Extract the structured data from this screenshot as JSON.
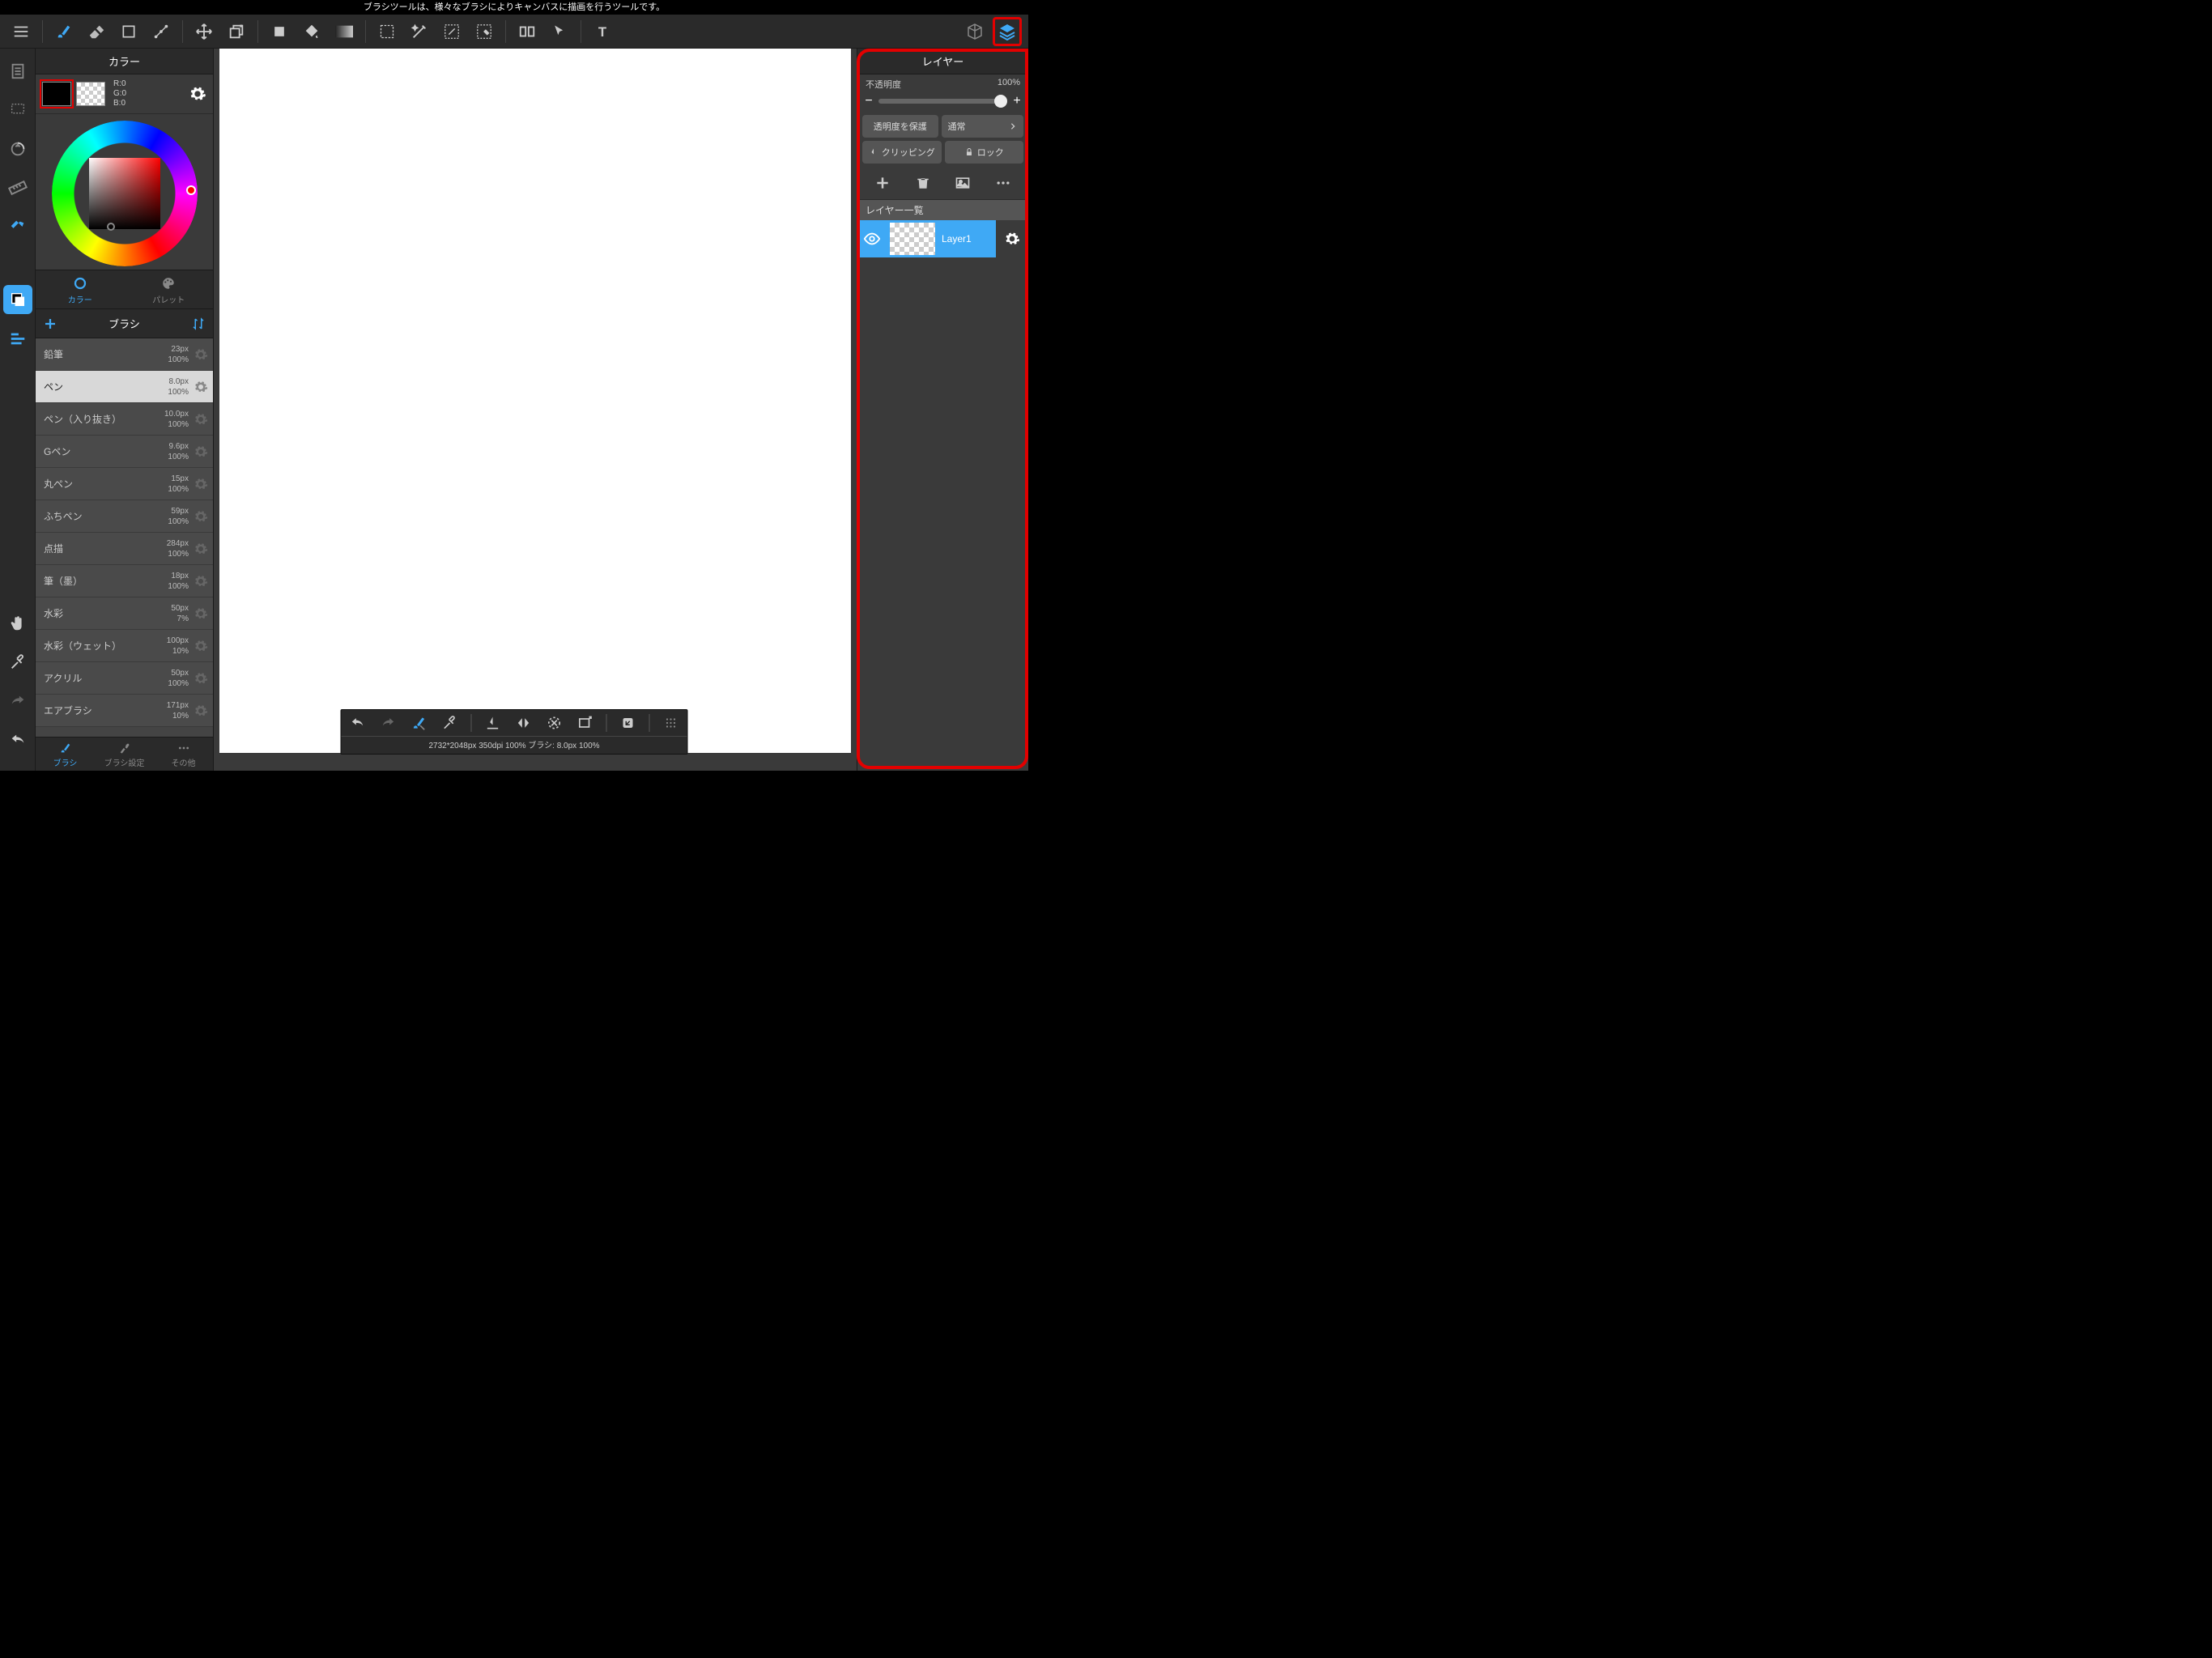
{
  "tooltip": "ブラシツールは、様々なブラシによりキャンバスに描画を行うツールです。",
  "color_panel": {
    "title": "カラー",
    "rgb": {
      "r": "R:0",
      "g": "G:0",
      "b": "B:0"
    },
    "tabs": {
      "color": "カラー",
      "palette": "パレット"
    }
  },
  "brush_panel": {
    "title": "ブラシ",
    "items": [
      {
        "name": "鉛筆",
        "size": "23px",
        "opacity": "100%"
      },
      {
        "name": "ペン",
        "size": "8.0px",
        "opacity": "100%",
        "selected": true
      },
      {
        "name": "ペン（入り抜き）",
        "size": "10.0px",
        "opacity": "100%"
      },
      {
        "name": "Gペン",
        "size": "9.6px",
        "opacity": "100%"
      },
      {
        "name": "丸ペン",
        "size": "15px",
        "opacity": "100%"
      },
      {
        "name": "ふちペン",
        "size": "59px",
        "opacity": "100%"
      },
      {
        "name": "点描",
        "size": "284px",
        "opacity": "100%"
      },
      {
        "name": "筆（墨）",
        "size": "18px",
        "opacity": "100%"
      },
      {
        "name": "水彩",
        "size": "50px",
        "opacity": "7%"
      },
      {
        "name": "水彩（ウェット）",
        "size": "100px",
        "opacity": "10%"
      },
      {
        "name": "アクリル",
        "size": "50px",
        "opacity": "100%"
      },
      {
        "name": "エアブラシ",
        "size": "171px",
        "opacity": "10%"
      }
    ],
    "footer": {
      "brush": "ブラシ",
      "settings": "ブラシ設定",
      "other": "その他"
    }
  },
  "status_bar": "2732*2048px 350dpi 100% ブラシ: 8.0px 100%",
  "layer_panel": {
    "title": "レイヤー",
    "opacity_label": "不透明度",
    "opacity_value": "100%",
    "protect_alpha": "透明度を保護",
    "blend_mode": "通常",
    "clipping": "クリッピング",
    "lock": "ロック",
    "list_header": "レイヤー一覧",
    "layers": [
      {
        "name": "Layer1"
      }
    ]
  }
}
